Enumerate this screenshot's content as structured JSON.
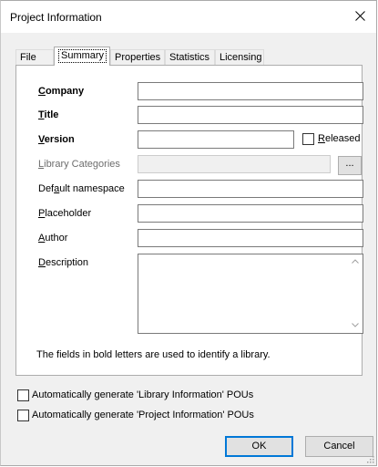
{
  "window": {
    "title": "Project Information"
  },
  "tabs": [
    {
      "label": "File",
      "active": false
    },
    {
      "label": "Summary",
      "active": true
    },
    {
      "label": "Properties",
      "active": false
    },
    {
      "label": "Statistics",
      "active": false
    },
    {
      "label": "Licensing",
      "active": false
    }
  ],
  "form": {
    "company": {
      "label_ul": "C",
      "label_rest": "ompany",
      "value": ""
    },
    "title": {
      "label_ul": "T",
      "label_rest": "itle",
      "value": ""
    },
    "version": {
      "label_ul": "V",
      "label_rest": "ersion",
      "value": ""
    },
    "released": {
      "label_ul": "R",
      "label_rest": "eleased",
      "checked": false
    },
    "library_categories": {
      "label_ul": "L",
      "label_rest": "ibrary Categories",
      "value": "",
      "enabled": false
    },
    "browse": {
      "label": "..."
    },
    "default_namespace": {
      "label_pre": "Def",
      "label_ul": "a",
      "label_rest": "ult namespace",
      "value": ""
    },
    "placeholder": {
      "label_ul": "P",
      "label_rest": "laceholder",
      "value": ""
    },
    "author": {
      "label_ul": "A",
      "label_rest": "uthor",
      "value": ""
    },
    "description": {
      "label_ul": "D",
      "label_rest": "escription",
      "value": ""
    },
    "hint": "The fields in bold letters are used to identify a library."
  },
  "options": {
    "auto_library_info": {
      "label": "Automatically generate 'Library Information' POUs",
      "checked": false
    },
    "auto_project_info": {
      "label": "Automatically generate 'Project Information' POUs",
      "checked": false
    }
  },
  "buttons": {
    "ok": "OK",
    "cancel": "Cancel"
  },
  "colors": {
    "accent": "#0078d7",
    "dialog_bg": "#f0f0f0",
    "panel_bg": "#ffffff",
    "disabled_text": "#6d6d6d"
  }
}
